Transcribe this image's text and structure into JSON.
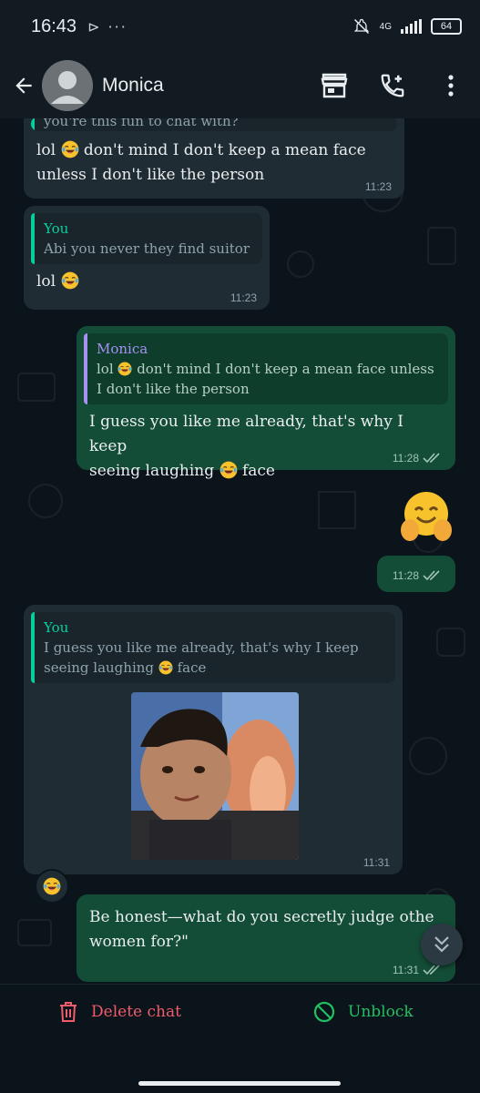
{
  "status_bar": {
    "time": "16:43",
    "extra": "⊳ ···",
    "network": "4G",
    "battery": "64"
  },
  "header": {
    "contact_name": "Monica",
    "icons": [
      "back-arrow-icon",
      "avatar",
      "store-icon",
      "add-call-icon",
      "more-vert-icon"
    ]
  },
  "messages": [
    {
      "direction": "in",
      "partial_quote": "you're this fun to chat with?",
      "text_before": "lol",
      "emoji": "face-with-tears-of-joy",
      "text_after": "don't mind I don't keep a mean face",
      "line2": "unless I don't like the person",
      "time": "11:23"
    },
    {
      "direction": "in",
      "quote_author": "You",
      "quote_text": "Abi you never they find suitor",
      "text": "lol",
      "emoji": "face-with-tears-of-joy",
      "time": "11:23"
    },
    {
      "direction": "out",
      "quote_author": "Monica",
      "quote_text_before": "lol",
      "quote_text_after": "don't mind I don't keep a mean face unless",
      "quote_line2": "I don't like the person",
      "line1": "I guess you like me already, that's why I keep",
      "line2_before": "seeing laughing",
      "line2_after": "face",
      "time": "11:28",
      "status": "read"
    },
    {
      "direction": "out",
      "big_emoji": "smiling-face-with-open-hands",
      "time": "11:28",
      "status": "read"
    },
    {
      "direction": "in",
      "quote_author": "You",
      "quote_line1": "I guess you like me already, that's why I keep",
      "quote_line2_before": "seeing laughing",
      "quote_line2_after": "face",
      "media": "gif-laughing-kid",
      "time": "11:31",
      "reaction": "face-with-tears-of-joy"
    },
    {
      "direction": "out",
      "line1": "Be honest—what do you secretly judge othe",
      "line2": "women for?\"",
      "time": "11:31",
      "status": "read"
    }
  ],
  "footer": {
    "delete_label": "Delete chat",
    "unblock_label": "Unblock"
  },
  "colors": {
    "background": "#0b141a",
    "incoming": "#1f2c33",
    "outgoing": "#144d37",
    "accent_green": "#21c063",
    "delete_red": "#f15c6d",
    "quote_green": "#06cf9c",
    "quote_purple": "#a791f2"
  }
}
